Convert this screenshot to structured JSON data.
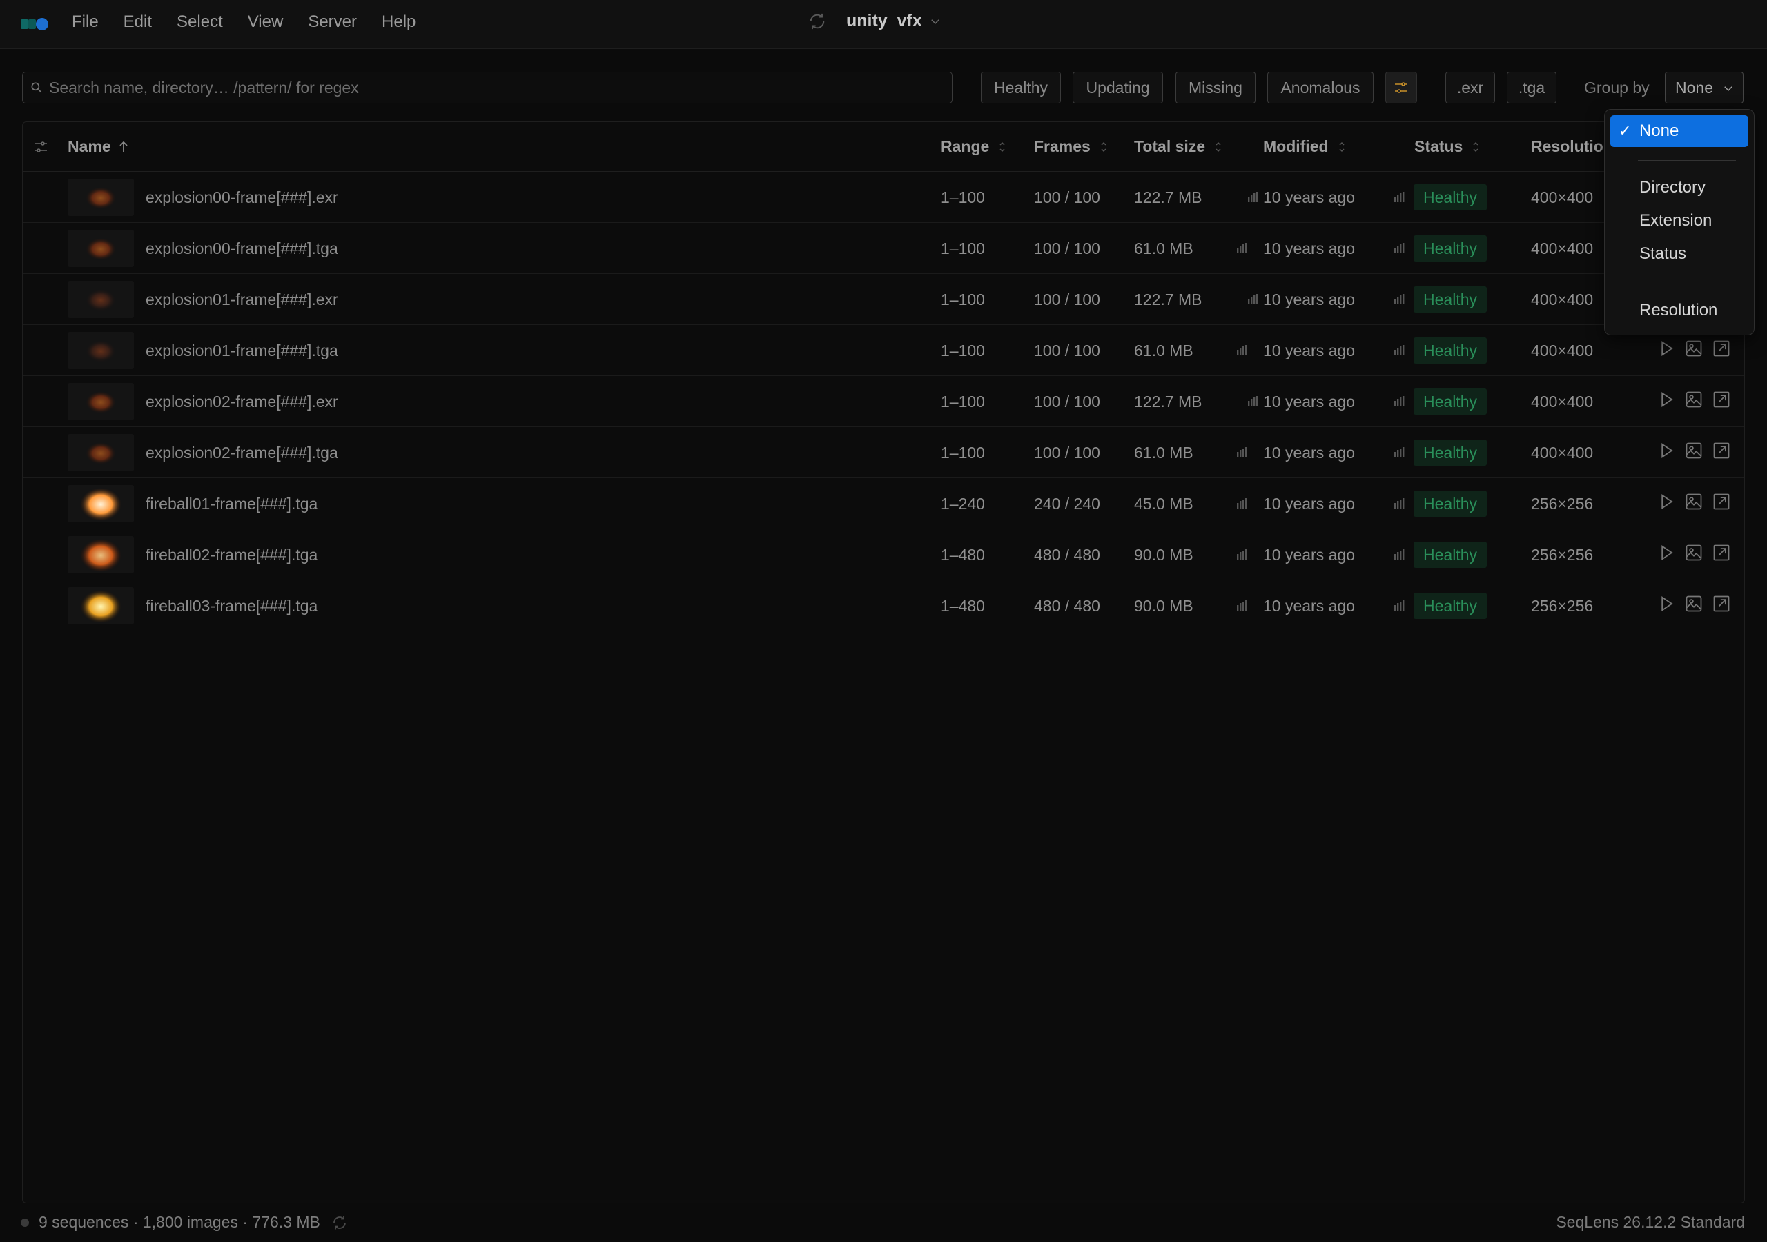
{
  "menubar": {
    "items": [
      "File",
      "Edit",
      "Select",
      "View",
      "Server",
      "Help"
    ],
    "project_title": "unity_vfx"
  },
  "toolbar": {
    "search_placeholder": "Search name, directory… /pattern/ for regex",
    "status_filters": [
      "Healthy",
      "Updating",
      "Missing",
      "Anomalous"
    ],
    "extension_filters": [
      ".exr",
      ".tga"
    ],
    "group_by_label": "Group by",
    "group_by_value": "None"
  },
  "table": {
    "columns": {
      "name": "Name",
      "range": "Range",
      "frames": "Frames",
      "total_size": "Total size",
      "modified": "Modified",
      "status": "Status",
      "resolution": "Resolutio"
    },
    "rows": [
      {
        "name": "explosion00-frame[###].exr",
        "range": "1–100",
        "frames": "100 / 100",
        "size": "122.7 MB",
        "modified": "10 years ago",
        "status": "Healthy",
        "resolution": "400×400",
        "thumb": "explosion-dark"
      },
      {
        "name": "explosion00-frame[###].tga",
        "range": "1–100",
        "frames": "100 / 100",
        "size": "61.0 MB",
        "modified": "10 years ago",
        "status": "Healthy",
        "resolution": "400×400",
        "thumb": "explosion-dark"
      },
      {
        "name": "explosion01-frame[###].exr",
        "range": "1–100",
        "frames": "100 / 100",
        "size": "122.7 MB",
        "modified": "10 years ago",
        "status": "Healthy",
        "resolution": "400×400",
        "thumb": "explosion-smoke"
      },
      {
        "name": "explosion01-frame[###].tga",
        "range": "1–100",
        "frames": "100 / 100",
        "size": "61.0 MB",
        "modified": "10 years ago",
        "status": "Healthy",
        "resolution": "400×400",
        "thumb": "explosion-smoke"
      },
      {
        "name": "explosion02-frame[###].exr",
        "range": "1–100",
        "frames": "100 / 100",
        "size": "122.7 MB",
        "modified": "10 years ago",
        "status": "Healthy",
        "resolution": "400×400",
        "thumb": "explosion-dark"
      },
      {
        "name": "explosion02-frame[###].tga",
        "range": "1–100",
        "frames": "100 / 100",
        "size": "61.0 MB",
        "modified": "10 years ago",
        "status": "Healthy",
        "resolution": "400×400",
        "thumb": "explosion-dark"
      },
      {
        "name": "fireball01-frame[###].tga",
        "range": "1–240",
        "frames": "240 / 240",
        "size": "45.0 MB",
        "modified": "10 years ago",
        "status": "Healthy",
        "resolution": "256×256",
        "thumb": "fireball-bright"
      },
      {
        "name": "fireball02-frame[###].tga",
        "range": "1–480",
        "frames": "480 / 480",
        "size": "90.0 MB",
        "modified": "10 years ago",
        "status": "Healthy",
        "resolution": "256×256",
        "thumb": "fireball-orange"
      },
      {
        "name": "fireball03-frame[###].tga",
        "range": "1–480",
        "frames": "480 / 480",
        "size": "90.0 MB",
        "modified": "10 years ago",
        "status": "Healthy",
        "resolution": "256×256",
        "thumb": "fireball-yellow"
      }
    ]
  },
  "group_by_menu": {
    "selected": "None",
    "options": [
      "None",
      "Directory",
      "Extension",
      "Status",
      "Resolution"
    ]
  },
  "statusbar": {
    "summary": "9 sequences · 1,800 images · 776.3 MB",
    "version": "SeqLens 26.12.2 Standard"
  },
  "colors": {
    "accent": "#0d6fe0",
    "healthy_text": "#2a8f5a",
    "healthy_bg": "#0f2419",
    "filter_icon": "#c8902a"
  },
  "icons": {
    "sort": "sort-ascending-icon",
    "column_settings": "sliders-icon",
    "row_actions": [
      "play-icon",
      "image-icon",
      "open-external-icon"
    ],
    "size_history": "bar-chart-icon"
  }
}
